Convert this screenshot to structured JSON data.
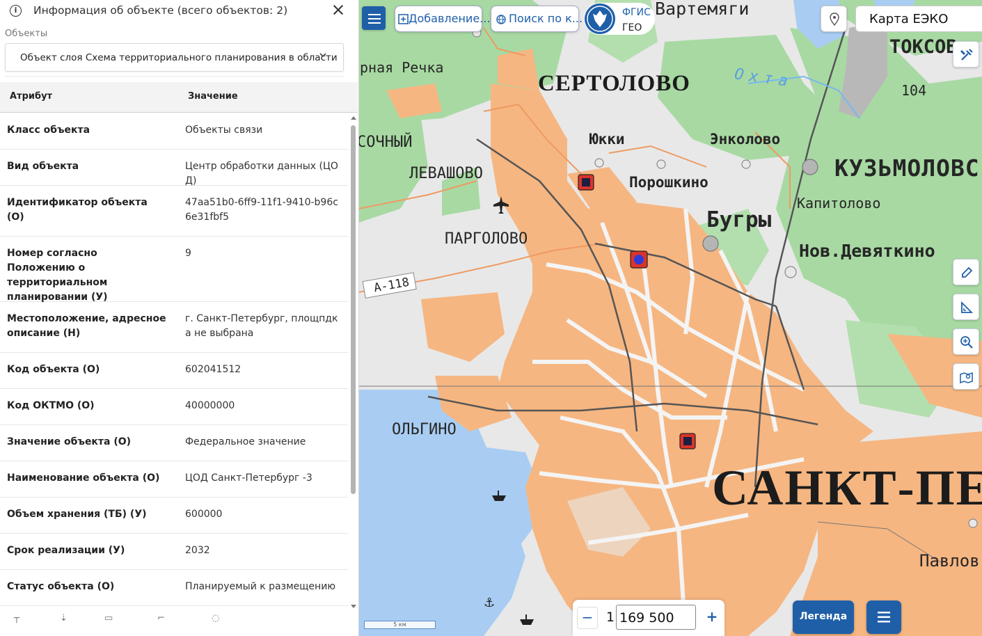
{
  "panel": {
    "title": "Информация об объекте (всего объектов: 2)",
    "objects_label": "Объекты",
    "selected_object": "Объект слоя Схема территориального планирования в области",
    "table_header": {
      "attribute": "Атрибут",
      "value": "Значение"
    },
    "rows": [
      {
        "attr": "Класс объекта",
        "value": "Объекты связи"
      },
      {
        "attr": "Вид объекта",
        "value": "Центр обработки данных (ЦОД)"
      },
      {
        "attr": "Идентификатор объекта (О)",
        "value": "47aa51b0-6ff9-11f1-9410-b96c6e31fbf5"
      },
      {
        "attr": "Номер согласно Положению о территориальном планировании (У)",
        "value": "9"
      },
      {
        "attr": "Местоположение, адресное описание (Н)",
        "value": "г. Санкт-Петербург, площпдка не выбрана"
      },
      {
        "attr": "Код объекта (О)",
        "value": "602041512"
      },
      {
        "attr": "Код ОКТМО (О)",
        "value": "40000000"
      },
      {
        "attr": "Значение объекта (О)",
        "value": "Федеральное значение"
      },
      {
        "attr": "Наименование объекта (О)",
        "value": "ЦОД Санкт-Петербург -3"
      },
      {
        "attr": "Объем хранения (ТБ) (У)",
        "value": "600000"
      },
      {
        "attr": "Срок реализации (У)",
        "value": "2032"
      },
      {
        "attr": "Статус объекта (О)",
        "value": "Планируемый к размещению"
      }
    ]
  },
  "toolbar": {
    "add_label": "Добавление...",
    "search_label": "Поиск по к...",
    "logo_line1": "ФГИС",
    "logo_line2": "ГЕО",
    "map_name": "Карта ЕЭКО"
  },
  "map_labels": {
    "vartemyagi": "Вартемяги",
    "toksovo": "ТОКСОВ",
    "chernaya_rechka": "рная Речка",
    "sertolovo": "СЕРТОЛОВО",
    "okhta": "Охта",
    "road_104": "104",
    "sochny": "СОЧНЫЙ",
    "yukki": "Юкки",
    "enkolovo": "Энколово",
    "kuzmolovsky": "КУЗЬМОЛОВС",
    "levashovo": "ЛЕВАШОВО",
    "poroshkino": "Порошкино",
    "kapitolovo": "Капитолово",
    "bugry": "Бугры",
    "pargolovo": "ПАРГОЛОВО",
    "nov_devyatkino": "Нов.Девяткино",
    "road_a118": "А-118",
    "olgino": "ОЛЬГИНО",
    "spb": "САНКТ-ПЕТЕ",
    "pavlovo": "Павлов"
  },
  "scale": {
    "bar_label": "5 км",
    "prefix": "1",
    "value": "169 500",
    "minus": "−",
    "plus": "+"
  },
  "legend_label": "Легенда",
  "colors": {
    "primary": "#1f5fa8",
    "urban": "#f6b681",
    "forest": "#a7d8a2",
    "water": "#a9cdf2",
    "marker": "#d9342b"
  }
}
